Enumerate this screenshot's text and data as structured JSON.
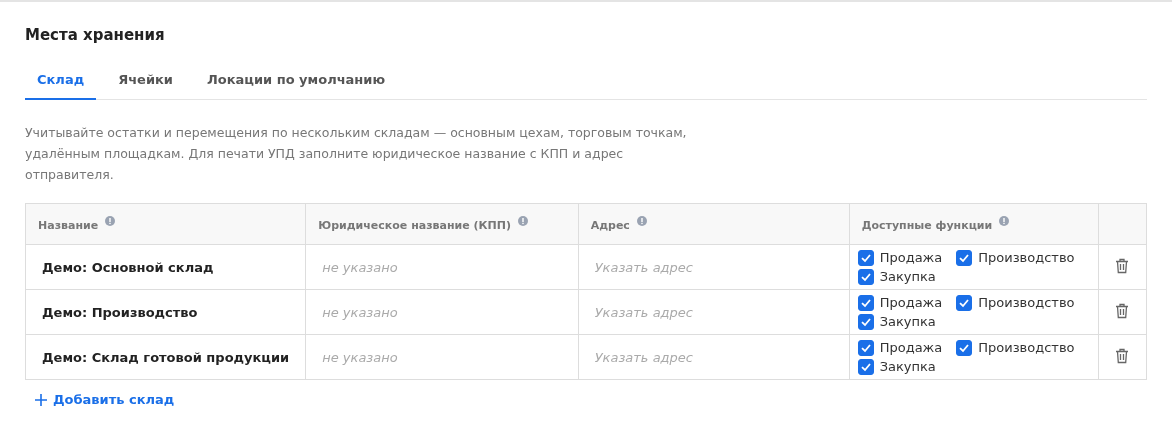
{
  "title": "Места хранения",
  "tabs": [
    {
      "label": "Склад",
      "selected": true
    },
    {
      "label": "Ячейки",
      "selected": false
    },
    {
      "label": "Локации по умолчанию",
      "selected": false
    }
  ],
  "description": "Учитывайте остатки и перемещения по нескольким складам — основным цехам, торговым точкам, удалённым площадкам. Для печати УПД заполните юридическое название с КПП и адрес отправителя.",
  "table": {
    "columns": [
      "Название",
      "Юридическое название (КПП)",
      "Адрес",
      "Доступные функции"
    ],
    "rows": [
      {
        "name": "Демо: Основной склад",
        "legal_name": {
          "placeholder": "не указано"
        },
        "address": {
          "placeholder": "Указать адрес"
        },
        "functions": [
          {
            "label": "Продажа",
            "checked": true
          },
          {
            "label": "Производство",
            "checked": true
          },
          {
            "label": "Закупка",
            "checked": true
          }
        ]
      },
      {
        "name": "Демо: Производство",
        "legal_name": {
          "placeholder": "не указано"
        },
        "address": {
          "placeholder": "Указать адрес"
        },
        "functions": [
          {
            "label": "Продажа",
            "checked": true
          },
          {
            "label": "Производство",
            "checked": true
          },
          {
            "label": "Закупка",
            "checked": true
          }
        ]
      },
      {
        "name": "Демо: Склад готовой продукции",
        "legal_name": {
          "placeholder": "не указано"
        },
        "address": {
          "placeholder": "Указать адрес"
        },
        "functions": [
          {
            "label": "Продажа",
            "checked": true
          },
          {
            "label": "Производство",
            "checked": true
          },
          {
            "label": "Закупка",
            "checked": true
          }
        ]
      }
    ]
  },
  "add_button": "Добавить склад"
}
